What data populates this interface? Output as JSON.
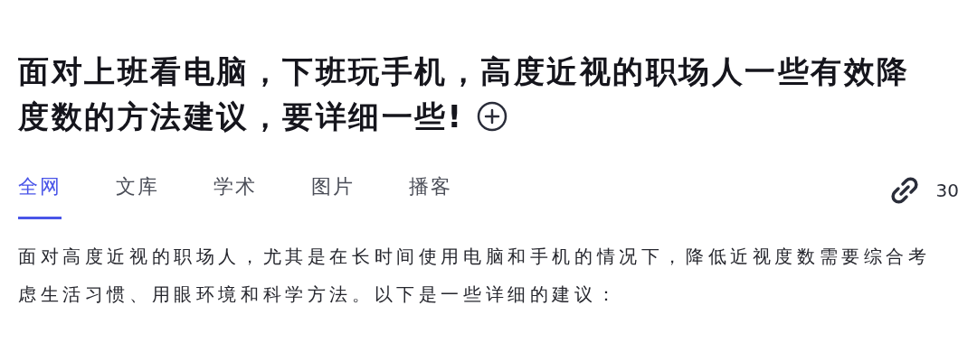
{
  "question": {
    "title_lines": [
      "面对上班看电脑，下班玩手机，高度近视的职场人一些有效降",
      "度数的方法建议，要详细一些!"
    ]
  },
  "tabs": [
    {
      "label": "全网",
      "selected": true
    },
    {
      "label": "文库",
      "selected": false
    },
    {
      "label": "学术",
      "selected": false
    },
    {
      "label": "图片",
      "selected": false
    },
    {
      "label": "播客",
      "selected": false
    }
  ],
  "sources": {
    "count": "30"
  },
  "answer": {
    "text": "面对高度近视的职场人，尤其是在长时间使用电脑和手机的情况下，降低近视度数需要综合考虑生活习惯、用眼环境和科学方法。以下是一些详细的建议："
  }
}
